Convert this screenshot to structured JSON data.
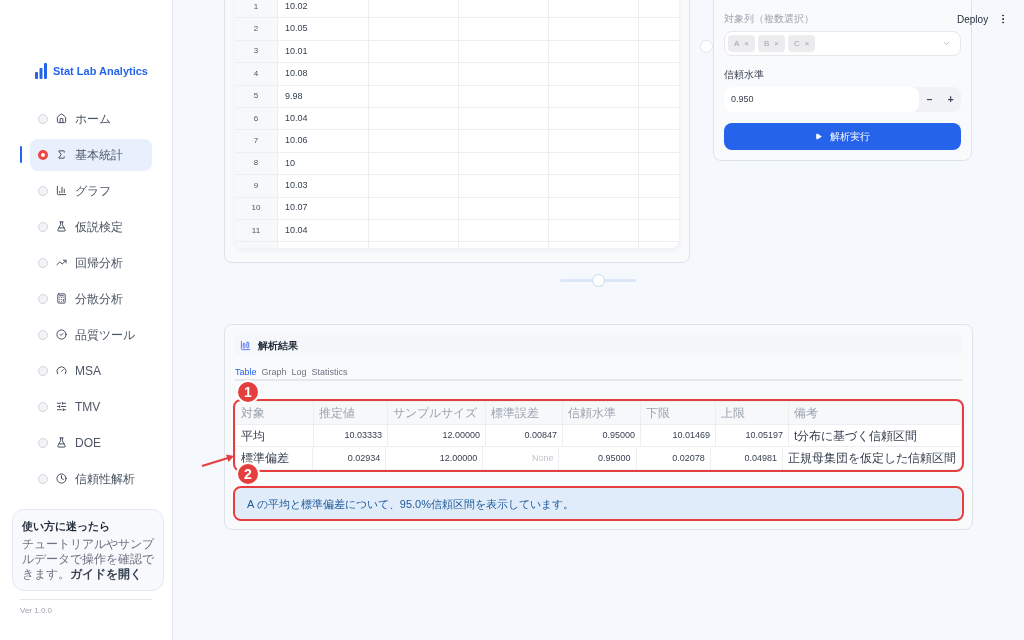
{
  "sidebar": {
    "logo": "Stat Lab Analytics",
    "items": [
      {
        "label": "ホーム",
        "selected": false
      },
      {
        "label": "基本統計",
        "selected": true
      },
      {
        "label": "グラフ",
        "selected": false
      },
      {
        "label": "仮説検定",
        "selected": false
      },
      {
        "label": "回帰分析",
        "selected": false
      },
      {
        "label": "分散分析",
        "selected": false
      },
      {
        "label": "品質ツール",
        "selected": false
      },
      {
        "label": "MSA",
        "selected": false
      },
      {
        "label": "TMV",
        "selected": false
      },
      {
        "label": "DOE",
        "selected": false
      },
      {
        "label": "信頼性解析",
        "selected": false
      }
    ],
    "help": {
      "title": "使い方に迷ったら",
      "body": "チュートリアルやサンプルデータで操作を確認できます。",
      "link": "ガイドを開く"
    },
    "version": "Ver 1.0.0"
  },
  "header": {
    "deploy": "Deploy"
  },
  "data_table": {
    "rows": [
      {
        "index": "1",
        "value": "10.02"
      },
      {
        "index": "2",
        "value": "10.05"
      },
      {
        "index": "3",
        "value": "10.01"
      },
      {
        "index": "4",
        "value": "10.08"
      },
      {
        "index": "5",
        "value": "9.98"
      },
      {
        "index": "6",
        "value": "10.04"
      },
      {
        "index": "7",
        "value": "10.06"
      },
      {
        "index": "8",
        "value": "10"
      },
      {
        "index": "9",
        "value": "10.03"
      },
      {
        "index": "10",
        "value": "10.07"
      },
      {
        "index": "11",
        "value": "10.04"
      }
    ]
  },
  "split_slider": {
    "level": 0.5
  },
  "settings": {
    "columns_label": "対象列（複数選択）",
    "columns": [
      {
        "label": "A",
        "remove": "×"
      },
      {
        "label": "B",
        "remove": "×"
      },
      {
        "label": "C",
        "remove": "×"
      }
    ],
    "confidence_label": "信頼水準",
    "confidence": "0.950",
    "decrement": "−",
    "increment": "+",
    "run_button": "解析実行"
  },
  "results": {
    "title": "解析結果",
    "tabs": [
      {
        "label": "Table",
        "selected": true
      },
      {
        "label": "Graph",
        "selected": false
      },
      {
        "label": "Log",
        "selected": false
      },
      {
        "label": "Statistics",
        "selected": false
      }
    ],
    "table": {
      "columns": [
        "対象",
        "推定値",
        "サンプルサイズ",
        "標準誤差",
        "信頼水準",
        "下限",
        "上限",
        "備考"
      ],
      "rows": [
        [
          {
            "text": "平均",
            "muted": false
          },
          {
            "text": "10.03333",
            "muted": false
          },
          {
            "text": "12.00000",
            "muted": false
          },
          {
            "text": "0.00847",
            "muted": false
          },
          {
            "text": "0.95000",
            "muted": false
          },
          {
            "text": "10.01469",
            "muted": false
          },
          {
            "text": "10.05197",
            "muted": false
          },
          {
            "text": "t分布に基づく信頼区間",
            "muted": false
          }
        ],
        [
          {
            "text": "標準偏差",
            "muted": false
          },
          {
            "text": "0.02934",
            "muted": false
          },
          {
            "text": "12.00000",
            "muted": false
          },
          {
            "text": "None",
            "muted": true
          },
          {
            "text": "0.95000",
            "muted": false
          },
          {
            "text": "0.02078",
            "muted": false
          },
          {
            "text": "0.04981",
            "muted": false
          },
          {
            "text": "正規母集団を仮定した信頼区間",
            "muted": false
          }
        ]
      ]
    },
    "message": "A の平均と標準偏差について、95.0%信頼区間を表示しています。",
    "annotations": [
      {
        "number": "1"
      },
      {
        "number": "2"
      }
    ]
  }
}
